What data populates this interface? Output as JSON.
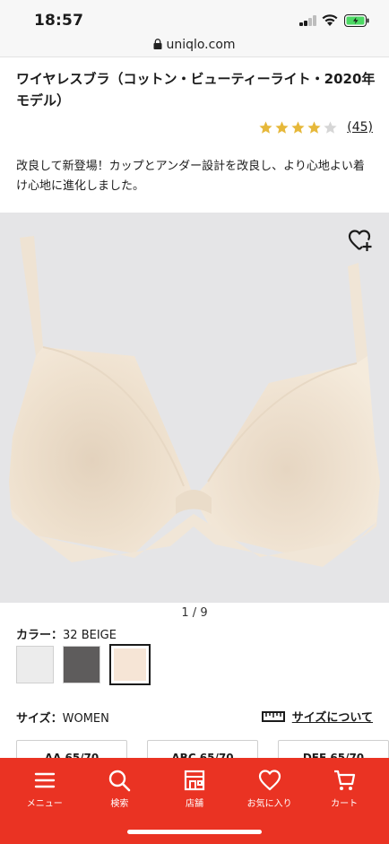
{
  "status_bar": {
    "time": "18:57"
  },
  "browser": {
    "url": "uniqlo.com"
  },
  "product": {
    "title": "ワイヤレスブラ（コットン・ビューティーライト・2020年モデル）",
    "rating": 4,
    "rating_max": 5,
    "review_count": "(45)",
    "description": "改良して新登場！カップとアンダー設計を改良し、より心地よい着け心地に進化しました。"
  },
  "gallery": {
    "pager": "1 / 9",
    "image_subject": "beige wireless bra",
    "background_color": "#e5e5e7"
  },
  "color": {
    "label": "カラー：",
    "selected_value": "32 BEIGE",
    "swatches": [
      {
        "name": "white",
        "color": "#ececec",
        "selected": false
      },
      {
        "name": "dark gray",
        "color": "#5e5c5c",
        "selected": false
      },
      {
        "name": "beige",
        "color": "#f6e5d6",
        "selected": true
      }
    ]
  },
  "size": {
    "label": "サイズ：",
    "selected_value": "WOMEN",
    "guide_label": "サイズについて",
    "options": [
      "AA 65/70",
      "ABC 65/70",
      "DEF 65/70"
    ]
  },
  "bottom_nav": {
    "color": "#ea3323",
    "items": [
      {
        "label": "メニュー",
        "icon": "menu-icon"
      },
      {
        "label": "検索",
        "icon": "search-icon"
      },
      {
        "label": "店舗",
        "icon": "store-icon"
      },
      {
        "label": "お気に入り",
        "icon": "heart-icon"
      },
      {
        "label": "カート",
        "icon": "cart-icon"
      }
    ]
  }
}
